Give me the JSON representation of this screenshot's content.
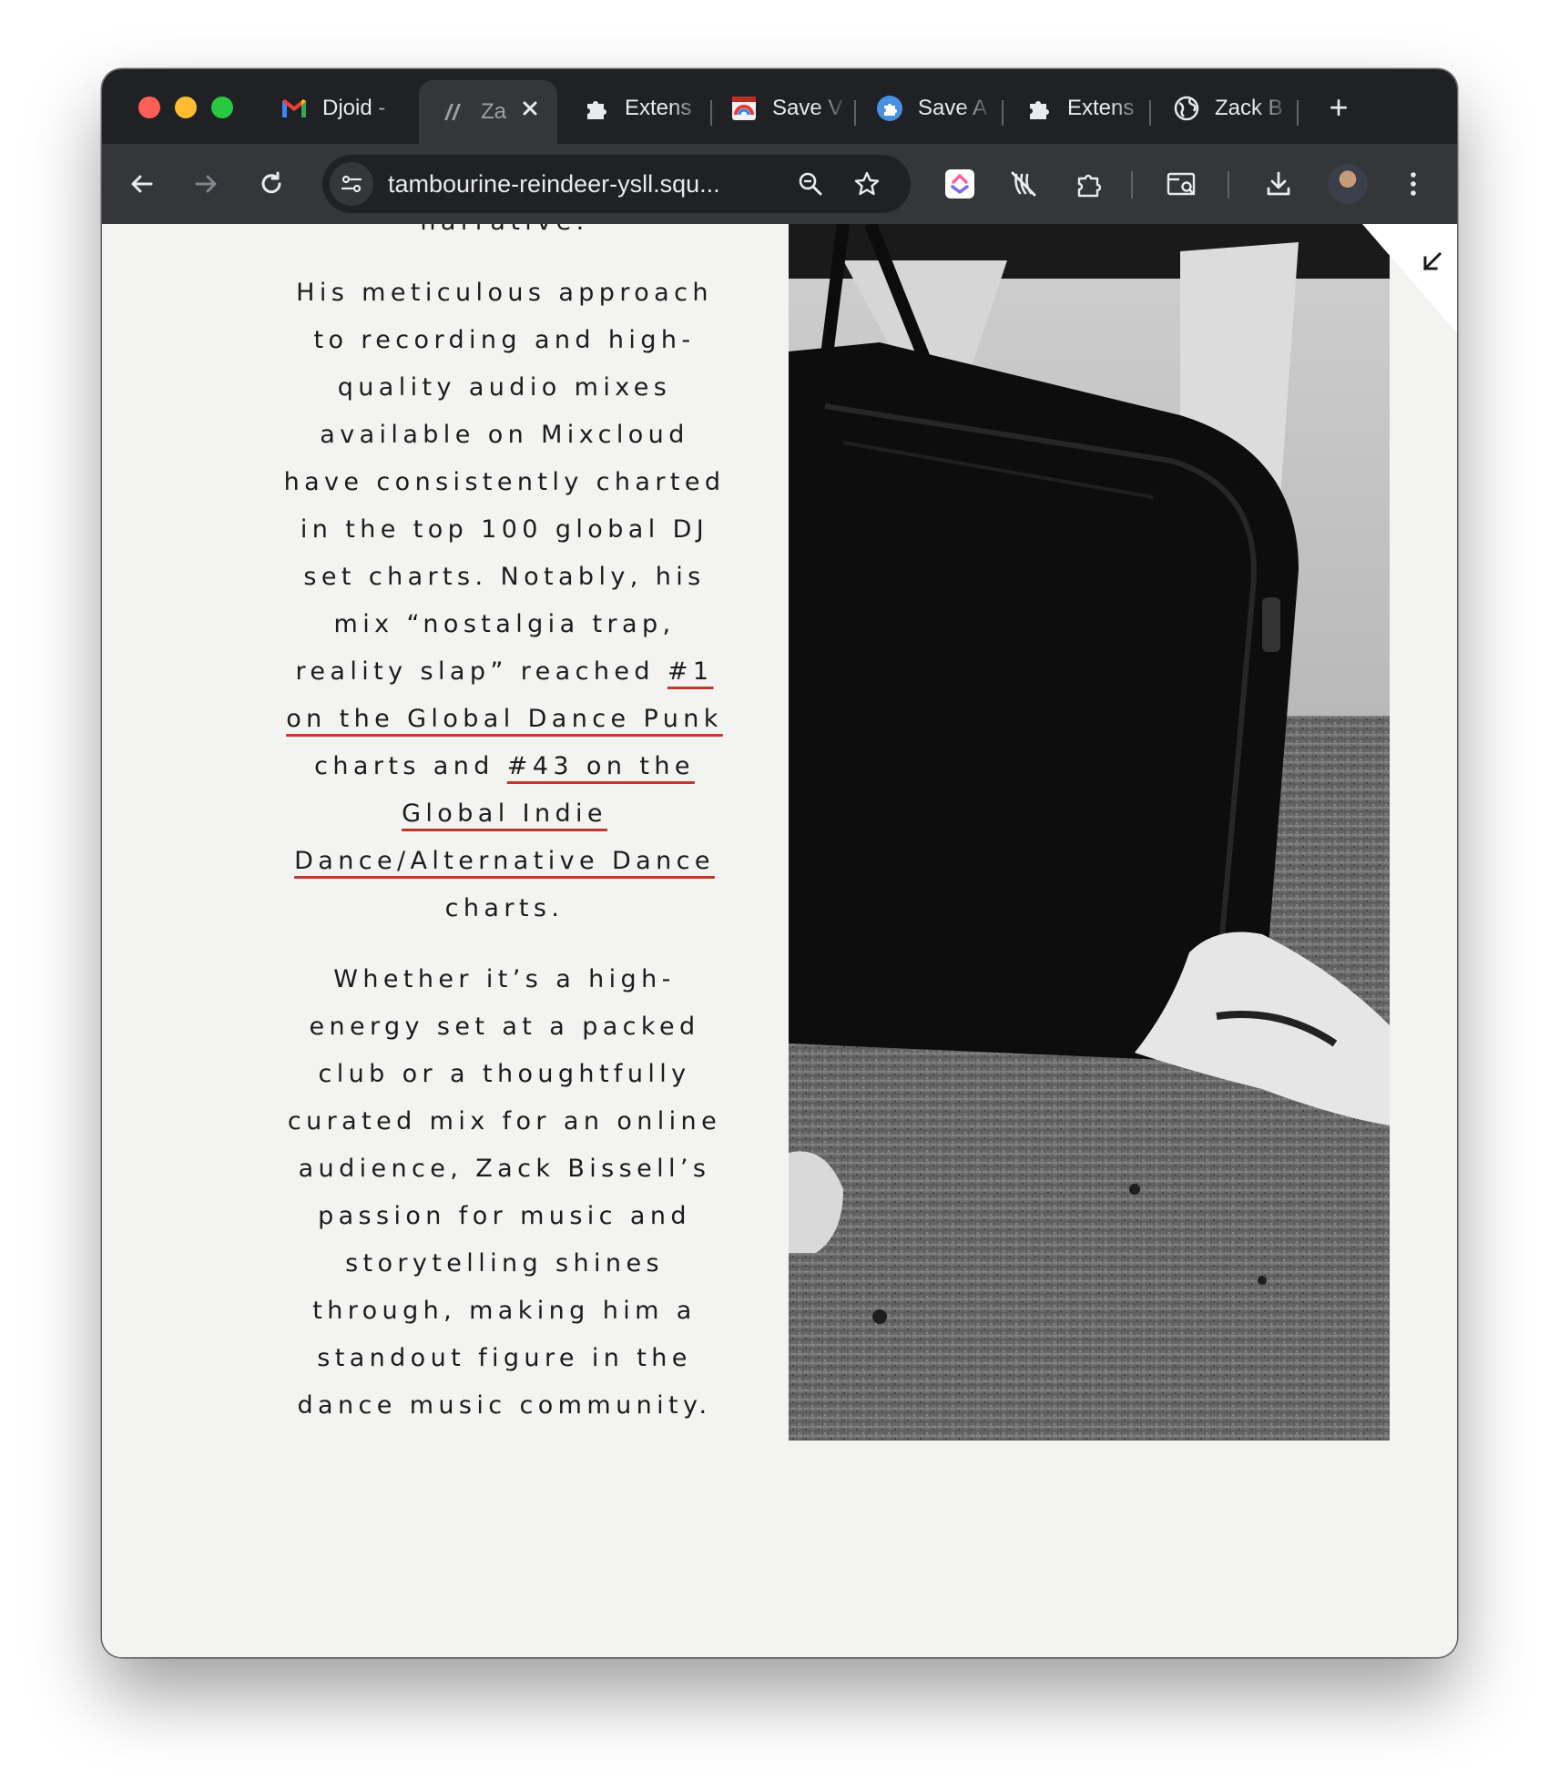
{
  "browser": {
    "tabs": [
      {
        "title": "Djoid -",
        "icon": "gmail-icon",
        "active": false
      },
      {
        "title": "Za",
        "icon": "squarespace-icon",
        "active": true
      },
      {
        "title": "Extens",
        "icon": "puzzle-icon",
        "active": false
      },
      {
        "title": "Save V",
        "icon": "save-extension-icon",
        "active": false
      },
      {
        "title": "Save A",
        "icon": "blue-puzzle-icon",
        "active": false
      },
      {
        "title": "Extens",
        "icon": "puzzle-icon",
        "active": false
      },
      {
        "title": "Zack B",
        "icon": "globe-icon",
        "active": false
      }
    ],
    "new_tab_label": "+",
    "address_bar": {
      "url": "tambourine-reindeer-ysll.squ..."
    },
    "toolbar_icons": [
      "back-icon",
      "forward-icon",
      "reload-icon",
      "site-info-icon",
      "zoom-icon",
      "bookmark-star-icon",
      "clickup-icon",
      "no-track-icon",
      "extensions-icon",
      "tab-search-icon",
      "download-icon",
      "profile-avatar",
      "menu-icon"
    ]
  },
  "content": {
    "p0_tail": "narrative.",
    "p1_text_a": "His meticulous approach to recording and high-quality audio mixes available on Mixcloud have consistently charted in the top 100 global DJ set charts. Notably, his mix “nostalgia trap, reality slap” reached ",
    "p1_link1": "#1 on the Global Dance Punk",
    "p1_text_b": " charts and ",
    "p1_link2": "#43 on the Global Indie Dance/Alternative Dance",
    "p1_text_c": " charts.",
    "p2_text": "Whether it’s a high-energy set at a packed club or a thoughtfully curated mix for an online audience, Zack Bissell’s passion for music and storytelling shines through, making him a standout figure in the dance music community."
  },
  "colors": {
    "link_underline": "#c0392b",
    "page_bg": "#f3f3f2",
    "chrome_dark": "#202124",
    "chrome_toolbar": "#35363a"
  }
}
